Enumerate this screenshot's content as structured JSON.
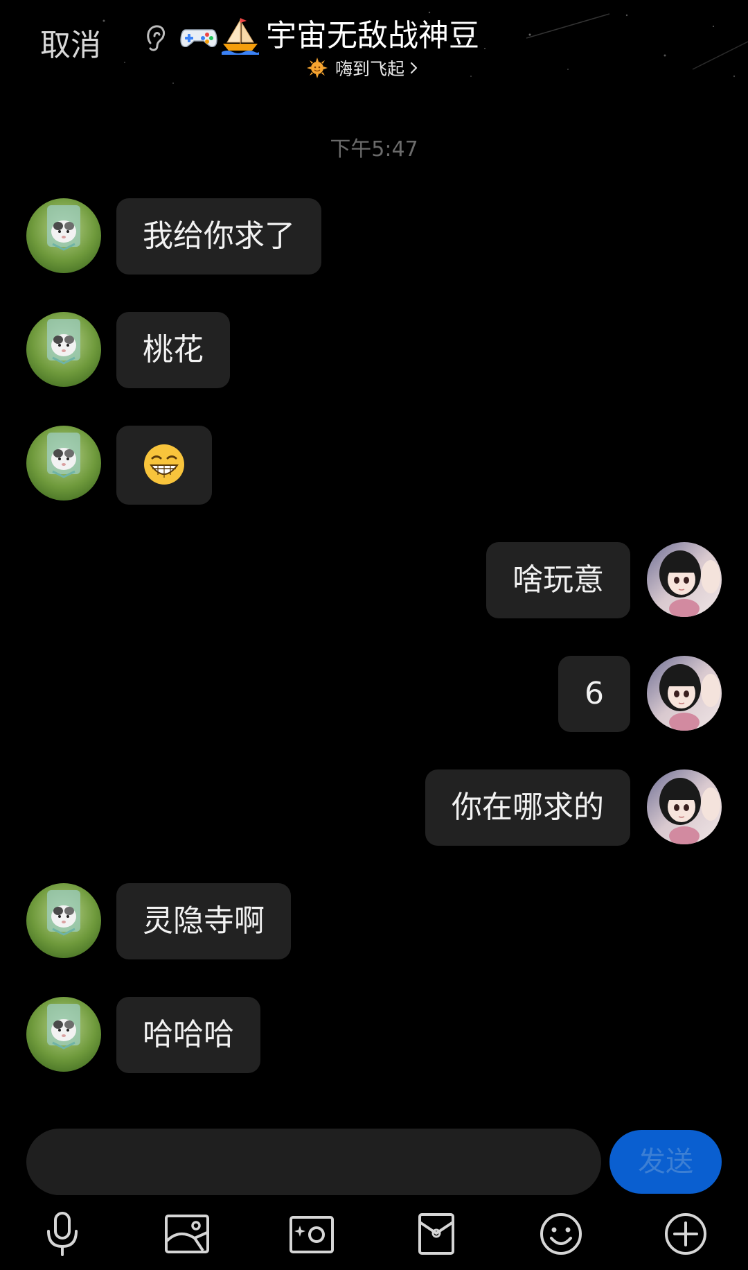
{
  "header": {
    "cancel_label": "取消",
    "title": "宇宙无敌战神豆",
    "status_text": "嗨到飞起",
    "title_icons": [
      "ear-icon",
      "gamepad-emoji",
      "sailboat-emoji"
    ],
    "status_icon": "sun-icon"
  },
  "timestamp": "下午5:47",
  "messages": [
    {
      "side": "left",
      "text": "我给你求了"
    },
    {
      "side": "left",
      "text": "桃花"
    },
    {
      "side": "left",
      "emoji": "grinning-face-emoji"
    },
    {
      "side": "right",
      "text": "啥玩意"
    },
    {
      "side": "right",
      "text": "6"
    },
    {
      "side": "right",
      "text": "你在哪求的"
    },
    {
      "side": "left",
      "text": "灵隐寺啊"
    },
    {
      "side": "left",
      "text": "哈哈哈"
    }
  ],
  "input": {
    "value": "",
    "placeholder": ""
  },
  "send_label": "发送",
  "toolbar": [
    "microphone-icon",
    "image-icon",
    "camera-icon",
    "red-packet-icon",
    "emoji-icon",
    "plus-icon"
  ],
  "colors": {
    "background": "#000000",
    "bubble": "#222222",
    "send_button": "#0a5fd0",
    "send_text": "#3c7fd4",
    "timestamp": "#6b6b6b"
  }
}
